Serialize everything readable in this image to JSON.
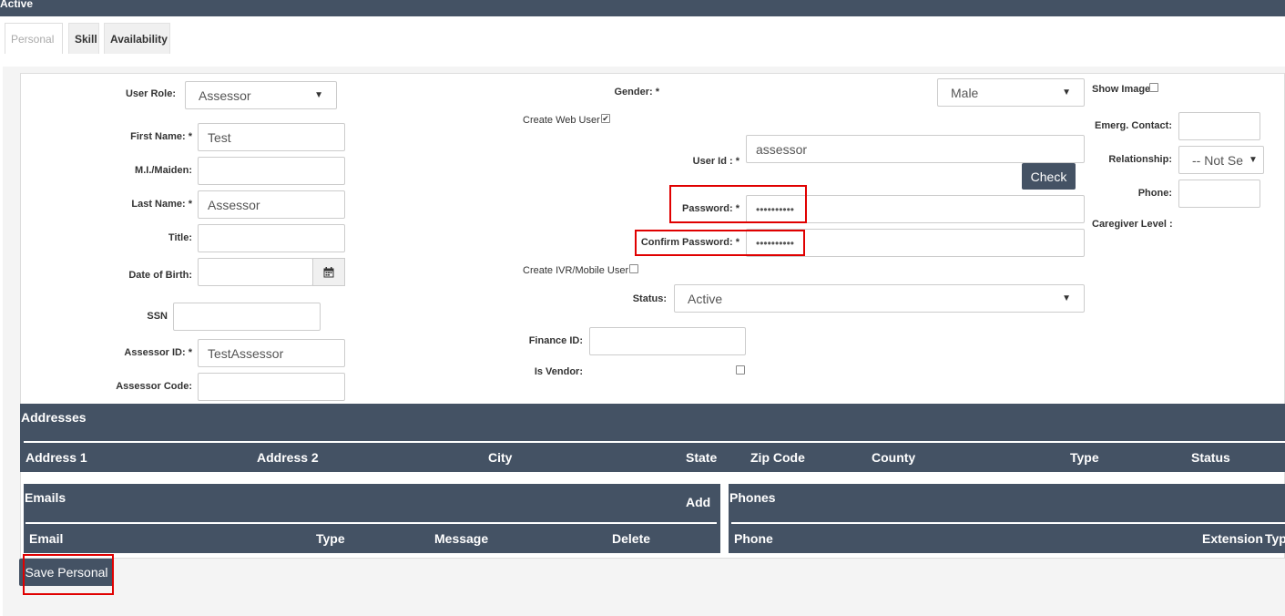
{
  "header": {
    "status_text": "Active"
  },
  "tabs": [
    {
      "label": "Personal",
      "active": true
    },
    {
      "label": "Skill",
      "active": false
    },
    {
      "label": "Availability",
      "active": false
    }
  ],
  "form": {
    "user_role": {
      "label": "User Role:",
      "value": "Assessor"
    },
    "first_name": {
      "label": "First Name: *",
      "value": "Test"
    },
    "mi_maiden": {
      "label": "M.I./Maiden:",
      "value": ""
    },
    "last_name": {
      "label": "Last Name: *",
      "value": "Assessor"
    },
    "title": {
      "label": "Title:",
      "value": ""
    },
    "dob": {
      "label": "Date of Birth:",
      "value": ""
    },
    "ssn": {
      "label": "SSN",
      "value": ""
    },
    "assessor_id": {
      "label": "Assessor ID: *",
      "value": "TestAssessor"
    },
    "assessor_code": {
      "label": "Assessor Code:",
      "value": ""
    },
    "gender": {
      "label": "Gender: *",
      "value": "Male"
    },
    "create_web_user": {
      "label": "Create Web User",
      "checked": true
    },
    "user_id": {
      "label": "User Id : *",
      "value": "assessor"
    },
    "check_button": "Check",
    "password": {
      "label": "Password: *",
      "value": "••••••••••"
    },
    "confirm_password": {
      "label": "Confirm Password: *",
      "value": "••••••••••"
    },
    "create_ivr": {
      "label": "Create IVR/Mobile User",
      "checked": false
    },
    "status": {
      "label": "Status:",
      "value": "Active"
    },
    "finance_id": {
      "label": "Finance ID:",
      "value": ""
    },
    "is_vendor": {
      "label": "Is Vendor:",
      "checked": false
    },
    "show_image": {
      "label": "Show Image",
      "checked": false
    },
    "emerg_contact": {
      "label": "Emerg. Contact:",
      "value": ""
    },
    "relationship": {
      "label": "Relationship:",
      "value": "-- Not Se"
    },
    "phone": {
      "label": "Phone:",
      "value": ""
    },
    "caregiver_level": {
      "label": "Caregiver Level :"
    }
  },
  "addresses": {
    "title": "Addresses",
    "columns": [
      "Address 1",
      "Address 2",
      "City",
      "State",
      "Zip Code",
      "County",
      "Type",
      "Status"
    ]
  },
  "emails": {
    "title": "Emails",
    "add_label": "Add",
    "columns": [
      "Email",
      "Type",
      "Message",
      "Delete"
    ]
  },
  "phones": {
    "title": "Phones",
    "columns": [
      "Phone",
      "Extension",
      "Typ"
    ]
  },
  "save_button": "Save Personal",
  "colors": {
    "header": "#445264",
    "highlight": "#e00000"
  }
}
